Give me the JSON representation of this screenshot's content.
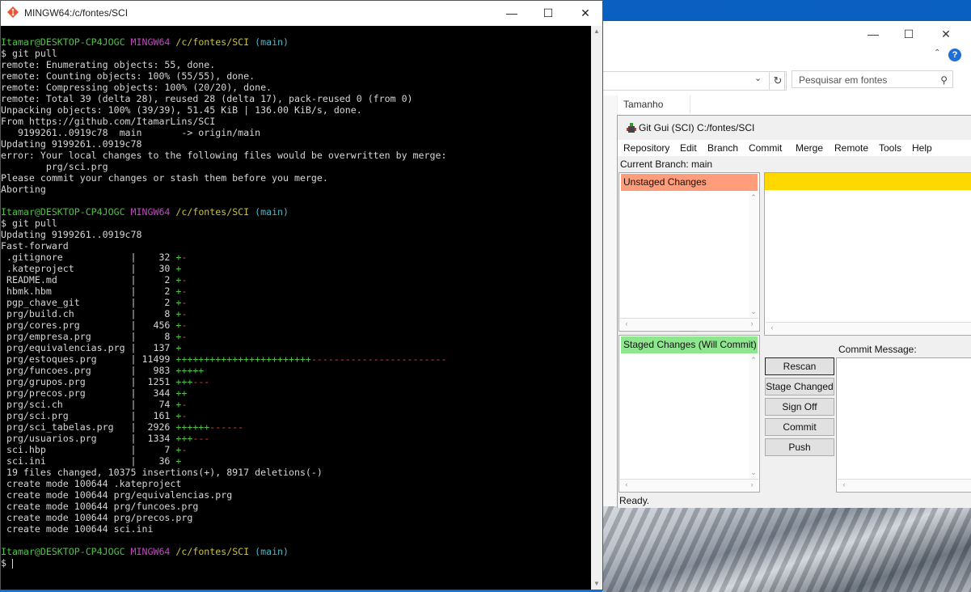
{
  "terminal": {
    "title": "MINGW64:/c/fontes/SCI",
    "lines": [
      [
        [
          "Itamar@DESKTOP-CP4JOGC",
          "g"
        ],
        [
          " ",
          ""
        ],
        [
          "MINGW64",
          "m"
        ],
        [
          " ",
          ""
        ],
        [
          "/c/fontes/SCI",
          "y"
        ],
        [
          " ",
          ""
        ],
        [
          "(main)",
          "c"
        ]
      ],
      [
        [
          "$ git pull",
          ""
        ]
      ],
      [
        [
          "remote: Enumerating objects: 55, done.",
          ""
        ]
      ],
      [
        [
          "remote: Counting objects: 100% (55/55), done.",
          ""
        ]
      ],
      [
        [
          "remote: Compressing objects: 100% (20/20), done.",
          ""
        ]
      ],
      [
        [
          "remote: Total 39 (delta 28), reused 28 (delta 17), pack-reused 0 (from 0)",
          ""
        ]
      ],
      [
        [
          "Unpacking objects: 100% (39/39), 51.45 KiB | 136.00 KiB/s, done.",
          ""
        ]
      ],
      [
        [
          "From https://github.com/ItamarLins/SCI",
          ""
        ]
      ],
      [
        [
          "   9199261..0919c78  main       -> origin/main",
          ""
        ]
      ],
      [
        [
          "Updating 9199261..0919c78",
          ""
        ]
      ],
      [
        [
          "error: Your local changes to the following files would be overwritten by merge:",
          ""
        ]
      ],
      [
        [
          "        prg/sci.prg",
          ""
        ]
      ],
      [
        [
          "Please commit your changes or stash them before you merge.",
          ""
        ]
      ],
      [
        [
          "Aborting",
          ""
        ]
      ],
      [
        [
          "",
          ""
        ]
      ],
      [
        [
          "Itamar@DESKTOP-CP4JOGC",
          "g"
        ],
        [
          " ",
          ""
        ],
        [
          "MINGW64",
          "m"
        ],
        [
          " ",
          ""
        ],
        [
          "/c/fontes/SCI",
          "y"
        ],
        [
          " ",
          ""
        ],
        [
          "(main)",
          "c"
        ]
      ],
      [
        [
          "$ git pull",
          ""
        ]
      ],
      [
        [
          "Updating 9199261..0919c78",
          ""
        ]
      ],
      [
        [
          "Fast-forward",
          ""
        ]
      ],
      [
        [
          " .gitignore            |    32 ",
          ""
        ],
        [
          "+",
          "g"
        ],
        [
          "-",
          "r"
        ]
      ],
      [
        [
          " .kateproject          |    30 ",
          ""
        ],
        [
          "+",
          "g"
        ]
      ],
      [
        [
          " README.md             |     2 ",
          ""
        ],
        [
          "+",
          "g"
        ],
        [
          "-",
          "r"
        ]
      ],
      [
        [
          " hbmk.hbm              |     2 ",
          ""
        ],
        [
          "+",
          "g"
        ],
        [
          "-",
          "r"
        ]
      ],
      [
        [
          " pgp_chave_git         |     2 ",
          ""
        ],
        [
          "+",
          "g"
        ],
        [
          "-",
          "r"
        ]
      ],
      [
        [
          " prg/build.ch          |     8 ",
          ""
        ],
        [
          "+",
          "g"
        ],
        [
          "-",
          "r"
        ]
      ],
      [
        [
          " prg/cores.prg         |   456 ",
          ""
        ],
        [
          "+",
          "g"
        ],
        [
          "-",
          "r"
        ]
      ],
      [
        [
          " prg/empresa.prg       |     8 ",
          ""
        ],
        [
          "+",
          "g"
        ],
        [
          "-",
          "r"
        ]
      ],
      [
        [
          " prg/equivalencias.prg |   137 ",
          ""
        ],
        [
          "+",
          "g"
        ]
      ],
      [
        [
          " prg/estoques.prg      | 11499 ",
          ""
        ],
        [
          "++++++++++++++++++++++++",
          "g"
        ],
        [
          "------------------------",
          "r"
        ]
      ],
      [
        [
          " prg/funcoes.prg       |   983 ",
          ""
        ],
        [
          "+++++",
          "g"
        ]
      ],
      [
        [
          " prg/grupos.prg        |  1251 ",
          ""
        ],
        [
          "+++",
          "g"
        ],
        [
          "---",
          "r"
        ]
      ],
      [
        [
          " prg/precos.prg        |   344 ",
          ""
        ],
        [
          "++",
          "g"
        ]
      ],
      [
        [
          " prg/sci.ch            |    74 ",
          ""
        ],
        [
          "+",
          "g"
        ],
        [
          "-",
          "r"
        ]
      ],
      [
        [
          " prg/sci.prg           |   161 ",
          ""
        ],
        [
          "+",
          "g"
        ],
        [
          "-",
          "r"
        ]
      ],
      [
        [
          " prg/sci_tabelas.prg   |  2926 ",
          ""
        ],
        [
          "++++++",
          "g"
        ],
        [
          "------",
          "r"
        ]
      ],
      [
        [
          " prg/usuarios.prg      |  1334 ",
          ""
        ],
        [
          "+++",
          "g"
        ],
        [
          "---",
          "r"
        ]
      ],
      [
        [
          " sci.hbp               |     7 ",
          ""
        ],
        [
          "+",
          "g"
        ],
        [
          "-",
          "r"
        ]
      ],
      [
        [
          " sci.ini               |    36 ",
          ""
        ],
        [
          "+",
          "g"
        ]
      ],
      [
        [
          " 19 files changed, 10375 insertions(+), 8917 deletions(-)",
          ""
        ]
      ],
      [
        [
          " create mode 100644 .kateproject",
          ""
        ]
      ],
      [
        [
          " create mode 100644 prg/equivalencias.prg",
          ""
        ]
      ],
      [
        [
          " create mode 100644 prg/funcoes.prg",
          ""
        ]
      ],
      [
        [
          " create mode 100644 prg/precos.prg",
          ""
        ]
      ],
      [
        [
          " create mode 100644 sci.ini",
          ""
        ]
      ],
      [
        [
          "",
          ""
        ]
      ],
      [
        [
          "Itamar@DESKTOP-CP4JOGC",
          "g"
        ],
        [
          " ",
          ""
        ],
        [
          "MINGW64",
          "m"
        ],
        [
          " ",
          ""
        ],
        [
          "/c/fontes/SCI",
          "y"
        ],
        [
          " ",
          ""
        ],
        [
          "(main)",
          "c"
        ]
      ],
      [
        [
          "$ ",
          ""
        ]
      ]
    ]
  },
  "explorer": {
    "search_placeholder": "Pesquisar em fontes",
    "column_size": "Tamanho"
  },
  "gitgui": {
    "title": "Git Gui (SCI) C:/fontes/SCI",
    "menu": [
      "Repository",
      "Edit",
      "Branch",
      "Commit",
      "Merge",
      "Remote",
      "Tools",
      "Help"
    ],
    "current_branch": "Current Branch: main",
    "unstaged_label": "Unstaged Changes",
    "staged_label": "Staged Changes (Will Commit)",
    "commit_message_label": "Commit Message:",
    "buttons": {
      "rescan": "Rescan",
      "stage_changed": "Stage Changed",
      "sign_off": "Sign Off",
      "commit": "Commit",
      "push": "Push"
    },
    "status": "Ready.",
    "colors": {
      "unstaged": "#ff9c7a",
      "staged": "#8ee68e",
      "diff_header": "#ffd800"
    }
  }
}
